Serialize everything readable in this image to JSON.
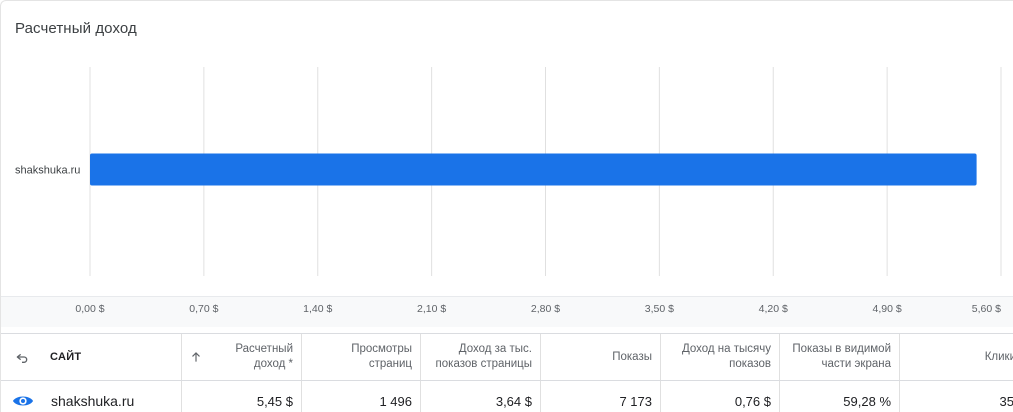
{
  "card": {
    "title": "Расчетный доход"
  },
  "chart_data": {
    "type": "bar",
    "orientation": "horizontal",
    "title": "Расчетный доход",
    "categories": [
      "shakshuka.ru"
    ],
    "values": [
      5.45
    ],
    "xlim": [
      0,
      5.6
    ],
    "x_ticks": [
      "0,00 $",
      "0,70 $",
      "1,40 $",
      "2,10 $",
      "2,80 $",
      "3,50 $",
      "4,20 $",
      "4,90 $",
      "5,60 $"
    ],
    "grid": true,
    "bar_color": "#1a73e8"
  },
  "table": {
    "headers": {
      "site": "САЙТ",
      "revenue_line1": "Расчетный",
      "revenue_line2": "доход *",
      "pageviews_line1": "Просмотры",
      "pageviews_line2": "страниц",
      "rpm_line1": "Доход за тыс.",
      "rpm_line2": "показов страницы",
      "impressions": "Показы",
      "impr_rpm_line1": "Доход на тысячу",
      "impr_rpm_line2": "показов",
      "viewability_line1": "Показы в видимой",
      "viewability_line2": "части экрана",
      "clicks": "Клики"
    },
    "rows": [
      {
        "site": "shakshuka.ru",
        "revenue": "5,45 $",
        "pageviews": "1 496",
        "rpm": "3,64 $",
        "impressions": "7 173",
        "impr_rpm": "0,76 $",
        "viewability": "59,28 %",
        "clicks": "35"
      }
    ]
  },
  "colors": {
    "accent": "#1a73e8",
    "grid": "#e0e0e0"
  },
  "icons": {
    "back": "undo-arrow-icon",
    "sort": "arrow-up-icon",
    "visibility": "eye-icon"
  }
}
